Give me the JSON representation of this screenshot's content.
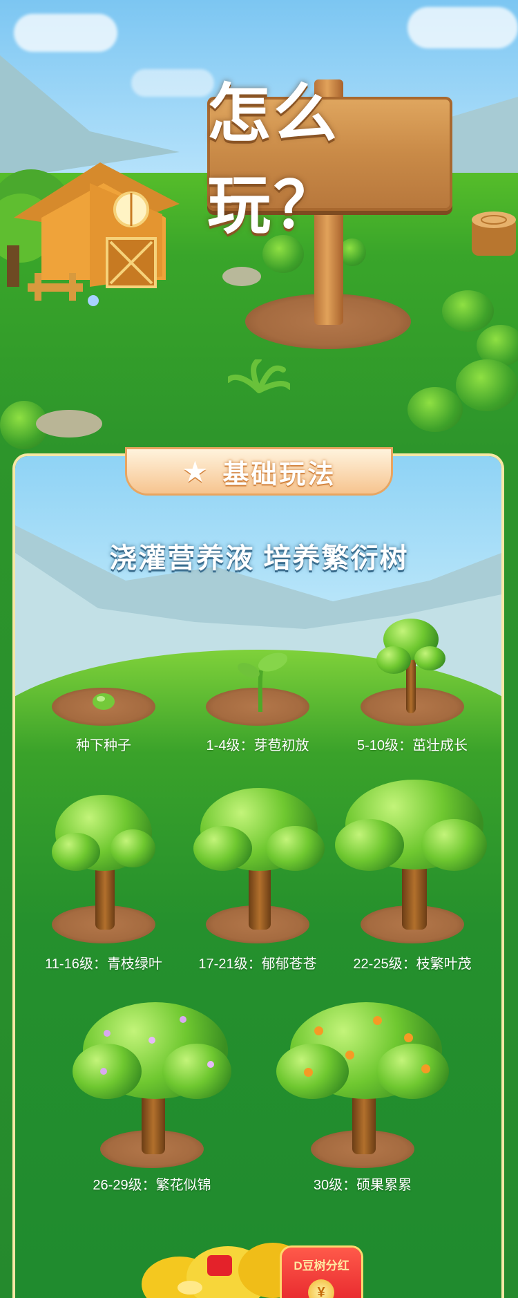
{
  "header": {
    "sign_title": "怎么玩？"
  },
  "section": {
    "ribbon_title": "基础玩法",
    "ribbon_icon": "star-icon",
    "slogan": "浇灌营养液  培养繁衍树"
  },
  "stages": [
    {
      "label": "种下种子"
    },
    {
      "label": "1-4级：芽苞初放"
    },
    {
      "label": "5-10级：茁壮成长"
    },
    {
      "label": "11-16级：青枝绿叶"
    },
    {
      "label": "17-21级：郁郁苍苍"
    },
    {
      "label": "22-25级：枝繁叶茂"
    },
    {
      "label": "26-29级：繁花似锦"
    },
    {
      "label": "30级：硕果累累"
    }
  ],
  "bonus": {
    "redpacket_label": "D豆树分红",
    "coin_symbol": "¥"
  },
  "colors": {
    "grass": "#2d952b",
    "sky": "#7cc6f2",
    "wood": "#c98a47",
    "ribbon": "#f6c48f",
    "redpacket": "#e4222a"
  }
}
